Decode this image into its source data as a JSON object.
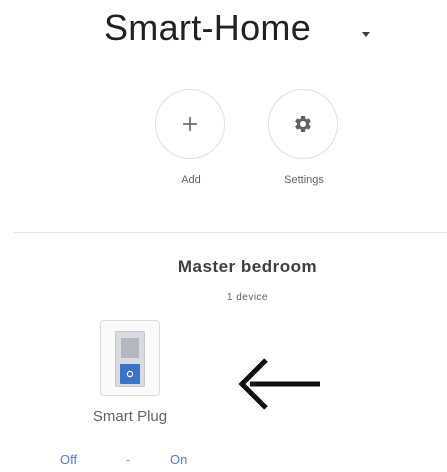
{
  "header": {
    "title": "Smart-Home",
    "dropdown_icon": "caret-down-icon"
  },
  "actions": [
    {
      "label": "Add",
      "icon": "plus-icon"
    },
    {
      "label": "Settings",
      "icon": "gear-icon"
    }
  ],
  "room": {
    "name": "Master bedroom",
    "device_count": "1 device"
  },
  "device": {
    "name": "Smart Plug",
    "icon": "smart-plug-icon",
    "accent_color": "#3d73c6",
    "controls": {
      "off_label": "Off",
      "separator": "-",
      "on_label": "On",
      "link_color": "#4a7fd4"
    }
  },
  "annotation": {
    "icon": "left-arrow-icon",
    "color": "#111111"
  }
}
